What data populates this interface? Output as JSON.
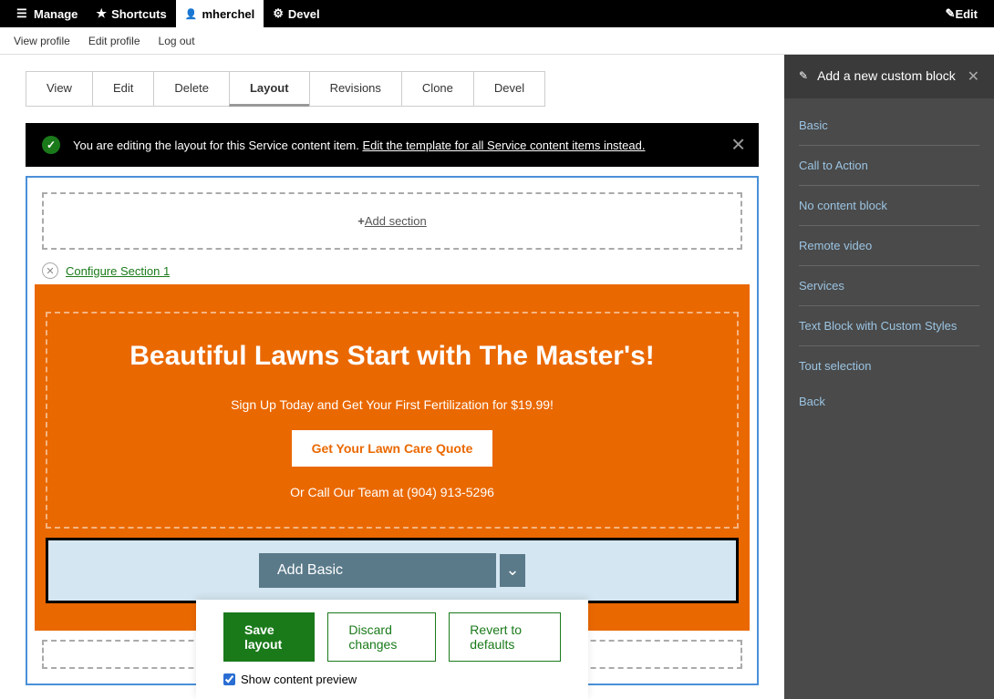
{
  "admin": {
    "manage": "Manage",
    "shortcuts": "Shortcuts",
    "user": "mherchel",
    "devel": "Devel",
    "edit": "Edit"
  },
  "secondary": {
    "view": "View profile",
    "editp": "Edit profile",
    "logout": "Log out"
  },
  "tabs": {
    "view": "View",
    "edit": "Edit",
    "delete": "Delete",
    "layout": "Layout",
    "revisions": "Revisions",
    "clone": "Clone",
    "devel": "Devel"
  },
  "status": {
    "text": "You are editing the layout for this Service content item. ",
    "link": "Edit the template for all Service content items instead."
  },
  "builder": {
    "add_section": "Add section",
    "configure": "Configure Section 1",
    "hero_title": "Beautiful Lawns Start with The Master's!",
    "hero_sub": "Sign Up Today and Get Your First Fertilization for $19.99!",
    "hero_btn": "Get Your Lawn Care Quote",
    "hero_call": "Or Call Our Team at (904) 913-5296",
    "add_block": "Add Basic"
  },
  "actions": {
    "save": "Save layout",
    "discard": "Discard changes",
    "revert": "Revert to defaults",
    "preview": "Show content preview"
  },
  "panel": {
    "title": "Add a new custom block",
    "links": {
      "basic": "Basic",
      "cta": "Call to Action",
      "nocontent": "No content block",
      "remote": "Remote video",
      "services": "Services",
      "textblock": "Text Block with Custom Styles",
      "tout": "Tout selection"
    },
    "back": "Back"
  }
}
